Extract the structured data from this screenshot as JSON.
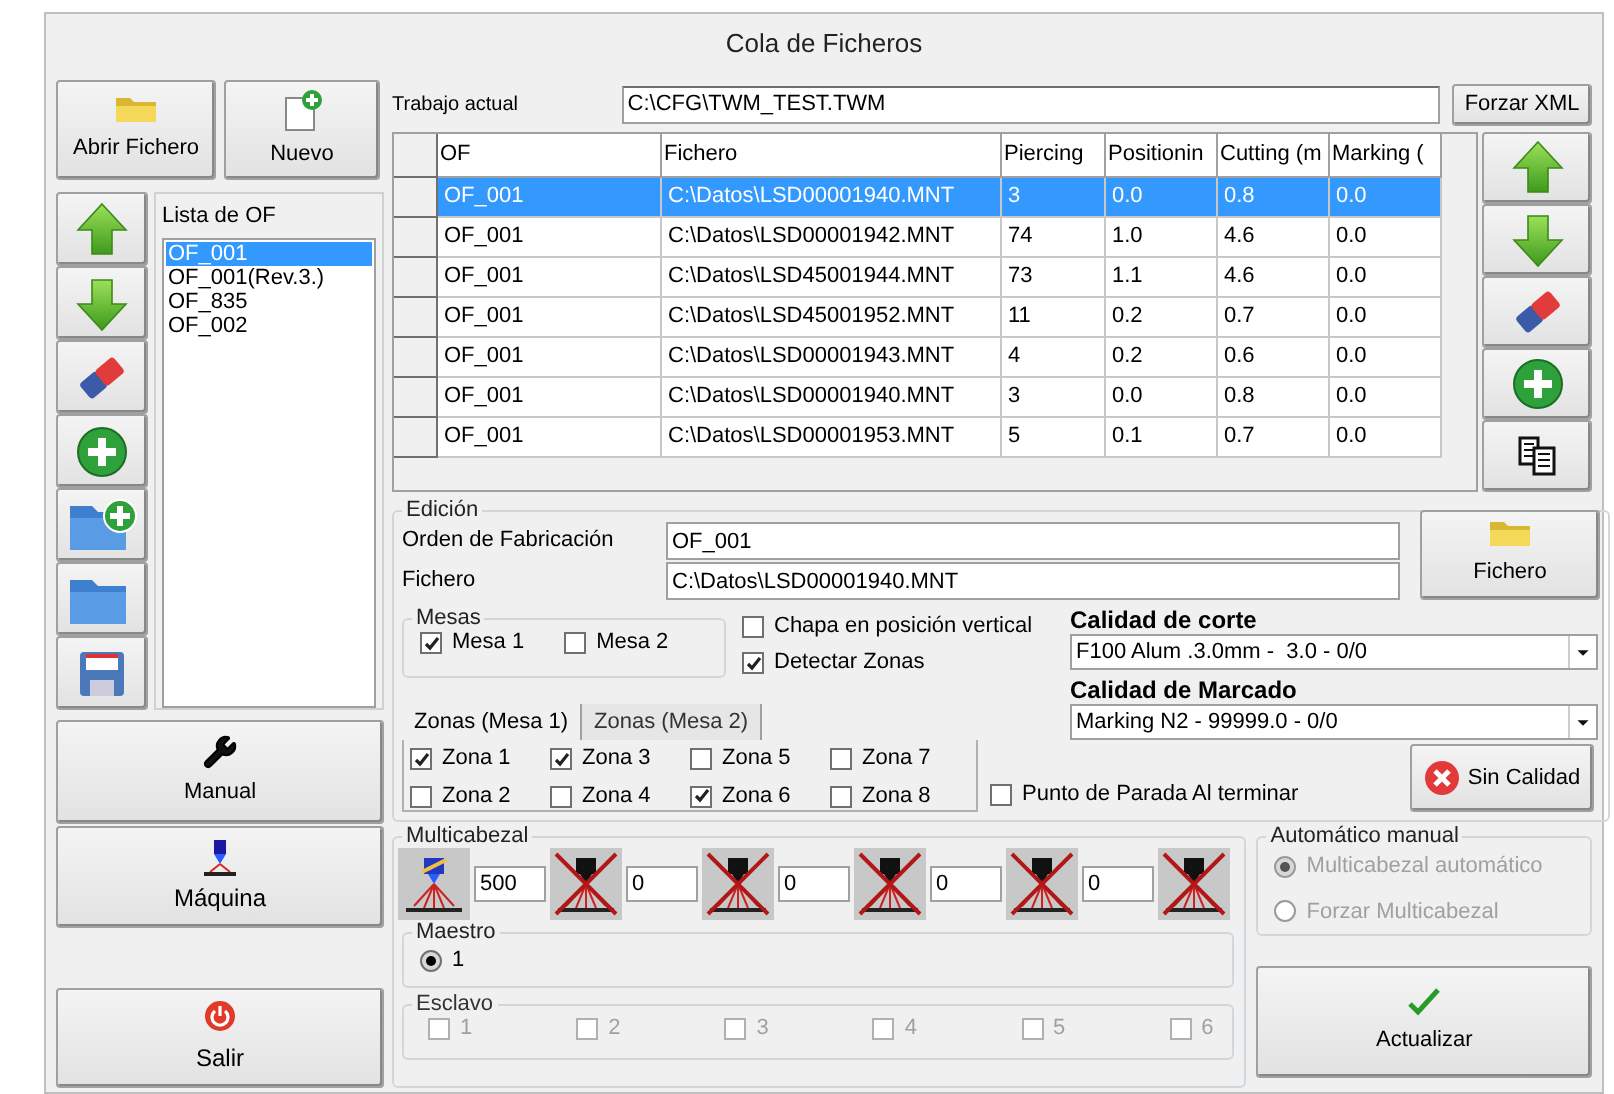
{
  "window": {
    "title": "Cola de Ficheros"
  },
  "top_buttons": [
    "Abrir Fichero",
    "Nuevo"
  ],
  "of_list": {
    "title": "Lista de OF",
    "items": [
      {
        "label": "OF_001",
        "selected": true
      },
      {
        "label": "OF_001(Rev.3.)",
        "selected": false
      },
      {
        "label": "OF_835",
        "selected": false
      },
      {
        "label": "OF_002",
        "selected": false
      }
    ]
  },
  "nav_buttons": [
    "Manual",
    "Máquina",
    "Salir"
  ],
  "current_job": {
    "label": "Trabajo actual",
    "value": "C:\\CFG\\TWM_TEST.TWM"
  },
  "force_button": "Forzar XML",
  "table": {
    "columns": [
      "OF",
      "Fichero",
      "Piercing",
      "Positionin",
      "Cutting (m",
      "Marking ("
    ],
    "rows": [
      {
        "selected": true,
        "cells": [
          "OF_001",
          "C:\\Datos\\LSD00001940.MNT",
          "3",
          "0.0",
          "0.8",
          "0.0"
        ]
      },
      {
        "selected": false,
        "cells": [
          "OF_001",
          "C:\\Datos\\LSD00001942.MNT",
          "74",
          "1.0",
          "4.6",
          "0.0"
        ]
      },
      {
        "selected": false,
        "cells": [
          "OF_001",
          "C:\\Datos\\LSD45001944.MNT",
          "73",
          "1.1",
          "4.6",
          "0.0"
        ]
      },
      {
        "selected": false,
        "cells": [
          "OF_001",
          "C:\\Datos\\LSD45001952.MNT",
          "11",
          "0.2",
          "0.7",
          "0.0"
        ]
      },
      {
        "selected": false,
        "cells": [
          "OF_001",
          "C:\\Datos\\LSD00001943.MNT",
          "4",
          "0.2",
          "0.6",
          "0.0"
        ]
      },
      {
        "selected": false,
        "cells": [
          "OF_001",
          "C:\\Datos\\LSD00001940.MNT",
          "3",
          "0.0",
          "0.8",
          "0.0"
        ]
      },
      {
        "selected": false,
        "cells": [
          "OF_001",
          "C:\\Datos\\LSD00001953.MNT",
          "5",
          "0.1",
          "0.7",
          "0.0"
        ]
      }
    ]
  },
  "edition": {
    "title": "Edición",
    "order_label": "Orden de Fabricación",
    "order_value": "OF_001",
    "file_label": "Fichero",
    "file_value": "C:\\Datos\\LSD00001940.MNT",
    "file_button": "Fichero"
  },
  "mesas": {
    "title": "Mesas",
    "items": [
      {
        "label": "Mesa 1",
        "checked": true
      },
      {
        "label": "Mesa 2",
        "checked": false
      }
    ]
  },
  "options": [
    {
      "label": "Chapa en posición vertical",
      "checked": false
    },
    {
      "label": "Detectar Zonas",
      "checked": true
    }
  ],
  "cut_quality": {
    "label": "Calidad de corte",
    "value": "F100 Alum .3.0mm -  3.0 - 0/0"
  },
  "mark_quality": {
    "label": "Calidad de Marcado",
    "value": "Marking N2 - 99999.0 - 0/0"
  },
  "zone_tabs": [
    {
      "label": "Zonas  (Mesa 1)",
      "selected": true
    },
    {
      "label": "Zonas  (Mesa 2)",
      "selected": false
    }
  ],
  "zones": [
    {
      "label": "Zona 1",
      "checked": true
    },
    {
      "label": "Zona 3",
      "checked": true
    },
    {
      "label": "Zona 5",
      "checked": false
    },
    {
      "label": "Zona 7",
      "checked": false
    },
    {
      "label": "Zona 2",
      "checked": false
    },
    {
      "label": "Zona 4",
      "checked": false
    },
    {
      "label": "Zona 6",
      "checked": true
    },
    {
      "label": "Zona 8",
      "checked": false
    }
  ],
  "stop_option": {
    "label": "Punto de Parada Al terminar",
    "checked": false
  },
  "no_quality_button": "Sin Calidad",
  "multihead": {
    "title": "Multicabezal",
    "heads": [
      {
        "active": true
      },
      {
        "active": false
      },
      {
        "active": false
      },
      {
        "active": false
      },
      {
        "active": false
      },
      {
        "active": false
      }
    ],
    "values": [
      "500",
      "0",
      "0",
      "0",
      "0"
    ]
  },
  "master": {
    "title": "Maestro",
    "options": [
      {
        "label": "1",
        "selected": true
      }
    ]
  },
  "slave": {
    "title": "Esclavo",
    "disabled": true,
    "items": [
      {
        "label": "1",
        "checked": false
      },
      {
        "label": "2",
        "checked": false
      },
      {
        "label": "3",
        "checked": false
      },
      {
        "label": "4",
        "checked": false
      },
      {
        "label": "5",
        "checked": false
      },
      {
        "label": "6",
        "checked": false
      }
    ]
  },
  "auto_manual": {
    "title": "Automático manual",
    "disabled": true,
    "options": [
      {
        "label": "Multicabezal automático",
        "selected": true
      },
      {
        "label": "Forzar Multicabezal",
        "selected": false
      }
    ]
  },
  "update_button": "Actualizar"
}
